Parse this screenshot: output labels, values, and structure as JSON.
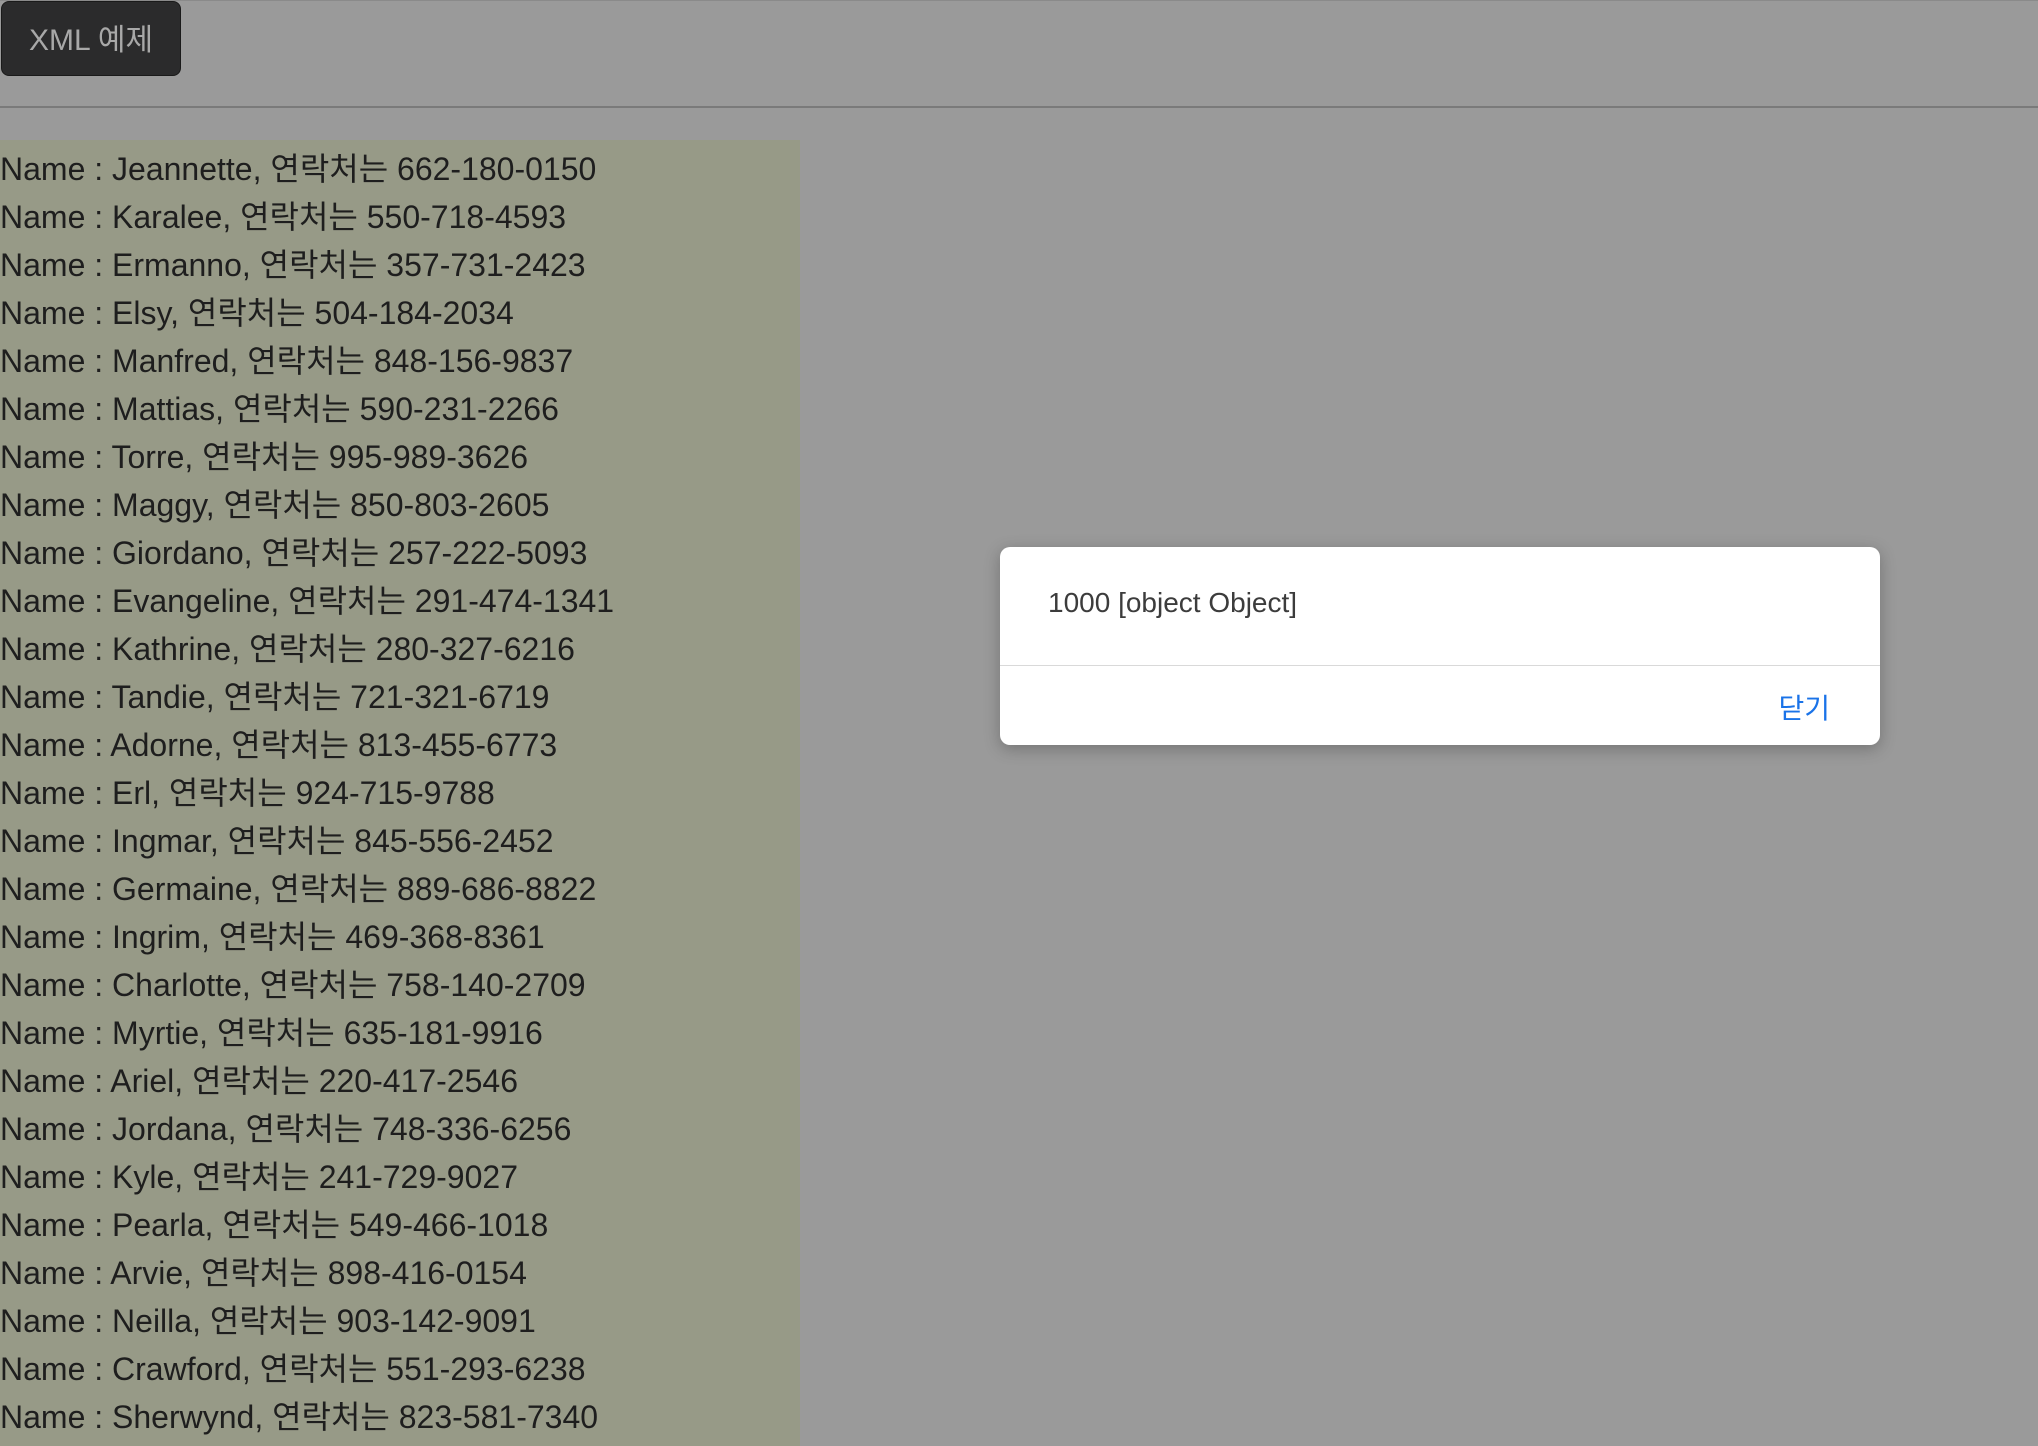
{
  "toolbar": {
    "xml_button_label": "XML 예제"
  },
  "results": [
    "Name : Jeannette, 연락처는 662-180-0150",
    "Name : Karalee, 연락처는 550-718-4593",
    "Name : Ermanno, 연락처는 357-731-2423",
    "Name : Elsy, 연락처는 504-184-2034",
    "Name : Manfred, 연락처는 848-156-9837",
    "Name : Mattias, 연락처는 590-231-2266",
    "Name : Torre, 연락처는 995-989-3626",
    "Name : Maggy, 연락처는 850-803-2605",
    "Name : Giordano, 연락처는 257-222-5093",
    "Name : Evangeline, 연락처는 291-474-1341",
    "Name : Kathrine, 연락처는 280-327-6216",
    "Name : Tandie, 연락처는 721-321-6719",
    "Name : Adorne, 연락처는 813-455-6773",
    "Name : Erl, 연락처는 924-715-9788",
    "Name : Ingmar, 연락처는 845-556-2452",
    "Name : Germaine, 연락처는 889-686-8822",
    "Name : Ingrim, 연락처는 469-368-8361",
    "Name : Charlotte, 연락처는 758-140-2709",
    "Name : Myrtie, 연락처는 635-181-9916",
    "Name : Ariel, 연락처는 220-417-2546",
    "Name : Jordana, 연락처는 748-336-6256",
    "Name : Kyle, 연락처는 241-729-9027",
    "Name : Pearla, 연락처는 549-466-1018",
    "Name : Arvie, 연락처는 898-416-0154",
    "Name : Neilla, 연락처는 903-142-9091",
    "Name : Crawford, 연락처는 551-293-6238",
    "Name : Sherwynd, 연락처는 823-581-7340"
  ],
  "dialog": {
    "message": "1000 [object Object]",
    "close_label": "닫기"
  },
  "colors": {
    "overlay_background": "#9a9a9a",
    "results_background": "#979a87",
    "button_background": "#2b2b2c",
    "link_blue": "#1a73e8"
  }
}
